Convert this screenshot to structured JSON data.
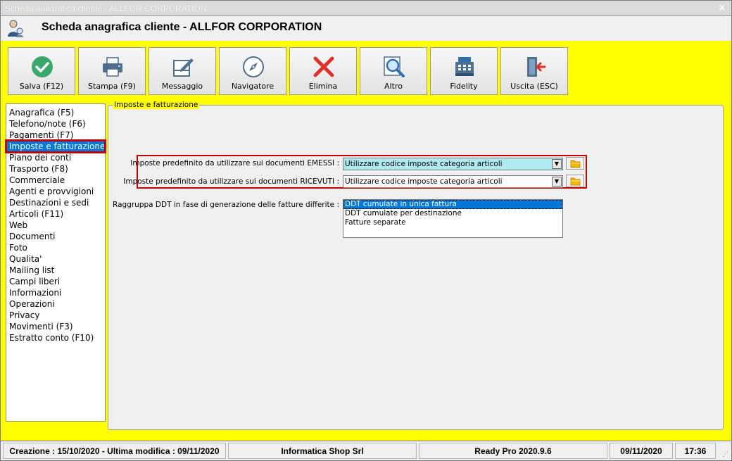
{
  "window": {
    "title": "Scheda anagrafica cliente - ALLFOR CORPORATION",
    "close_glyph": "×"
  },
  "header": {
    "title": "Scheda anagrafica cliente - ALLFOR CORPORATION",
    "icon": "customer-icon"
  },
  "toolbar": {
    "buttons": [
      {
        "label": "Salva (F12)",
        "icon": "check-circle-icon"
      },
      {
        "label": "Stampa (F9)",
        "icon": "printer-icon"
      },
      {
        "label": "Messaggio",
        "icon": "compose-message-icon"
      },
      {
        "label": "Navigatore",
        "icon": "compass-icon"
      },
      {
        "label": "Elimina",
        "icon": "delete-x-icon"
      },
      {
        "label": "Altro",
        "icon": "magnifier-icon"
      },
      {
        "label": "Fidelity",
        "icon": "cash-register-icon"
      },
      {
        "label": "Uscita (ESC)",
        "icon": "exit-door-icon"
      }
    ]
  },
  "sidebar": {
    "items": [
      "Anagrafica (F5)",
      "Telefono/note (F6)",
      "Pagamenti (F7)",
      "Imposte e fatturazione",
      "Piano dei conti",
      "Trasporto (F8)",
      "Commerciale",
      "Agenti e provvigioni",
      "Destinazioni e sedi",
      "Articoli (F11)",
      "Web",
      "Documenti",
      "Foto",
      "Qualita'",
      "Mailing list",
      "Campi liberi",
      "Informazioni",
      "Operazioni",
      "Privacy",
      "Movimenti (F3)",
      "Estratto conto (F10)"
    ],
    "selected_index": 3
  },
  "panel": {
    "legend": "Imposte e fatturazione",
    "emessi": {
      "label": "Imposte predefinito da utilizzare sui documenti EMESSI :",
      "value": "Utilizzare codice imposte categoria articoli"
    },
    "ricevuti": {
      "label": "Imposte predefinito da utilizzare sui documenti RICEVUTI :",
      "value": "Utilizzare codice imposte categoria articoli"
    },
    "ddt": {
      "label": "Raggruppa DDT in fase di generazione delle fatture differite :",
      "options": [
        "DDT cumulate in unica fattura",
        "DDT cumulate per destinazione",
        "Fatture separate"
      ],
      "selected_index": 0
    }
  },
  "status": {
    "dates": "Creazione : 15/10/2020 - Ultima modifica : 09/11/2020",
    "company": "Informatica Shop Srl",
    "version": "Ready Pro 2020.9.6",
    "date": "09/11/2020",
    "time": "17:36"
  },
  "colors": {
    "background_accent": "#ffff00",
    "highlight_border": "#c00000",
    "selection": "#0078d7",
    "combo_highlight": "#aeeaf0"
  }
}
